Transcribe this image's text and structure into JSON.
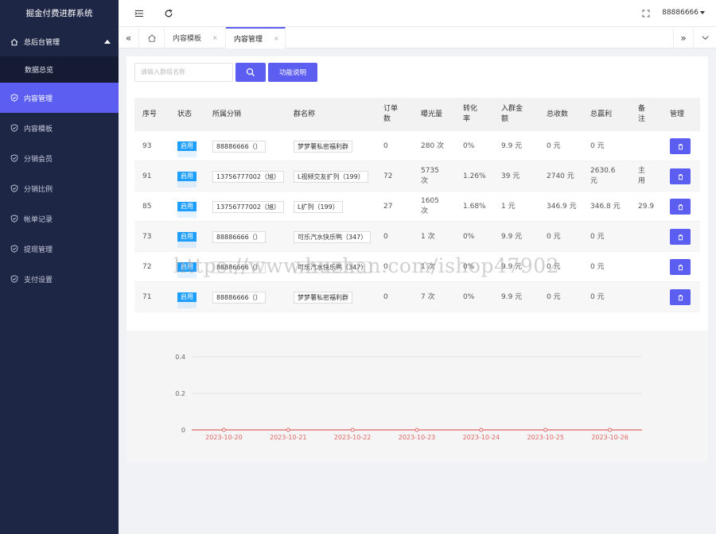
{
  "app": {
    "title": "掘金付费进群系统"
  },
  "sidebar": {
    "group": {
      "label": "总后台管理",
      "icon": "home-icon"
    },
    "subitems": [
      {
        "label": "数据总览"
      }
    ],
    "items": [
      {
        "label": "内容管理",
        "icon": "shield-icon",
        "active": true
      },
      {
        "label": "内容模板",
        "icon": "shield-icon"
      },
      {
        "label": "分销会员",
        "icon": "shield-icon"
      },
      {
        "label": "分销比例",
        "icon": "shield-icon"
      },
      {
        "label": "帐单记录",
        "icon": "shield-icon"
      },
      {
        "label": "提现管理",
        "icon": "shield-icon"
      },
      {
        "label": "支付设置",
        "icon": "shield-icon"
      }
    ]
  },
  "topbar": {
    "user": "88886666"
  },
  "tabs": [
    {
      "label": "内容模板",
      "close": "×"
    },
    {
      "label": "内容管理",
      "close": "×",
      "active": true
    }
  ],
  "toolbar": {
    "search_placeholder": "请输入群组名称",
    "help_label": "功能说明"
  },
  "table": {
    "headers": [
      "序号",
      "状态",
      "所属分销",
      "群名称",
      "订单数",
      "曝光量",
      "转化率",
      "入群金额",
      "总收数",
      "总赢利",
      "备注",
      "管理"
    ],
    "rows": [
      {
        "id": "93",
        "status": "启用",
        "distributor": "88886666（）",
        "group": "梦梦薯私密福利群",
        "orders": "0",
        "views": "280 次",
        "rate": "0%",
        "price": "9.9 元",
        "income": "0 元",
        "profit": "0 元",
        "note": ""
      },
      {
        "id": "91",
        "status": "启用",
        "distributor": "13756777002（旭）",
        "group": "L视频交友扩列（199）",
        "orders": "72",
        "views": "5735 次",
        "rate": "1.26%",
        "price": "39 元",
        "income": "2740 元",
        "profit": "2630.6 元",
        "note": "主用"
      },
      {
        "id": "85",
        "status": "启用",
        "distributor": "13756777002（旭）",
        "group": "L扩列（199）",
        "orders": "27",
        "views": "1605 次",
        "rate": "1.68%",
        "price": "1 元",
        "income": "346.9 元",
        "profit": "346.8 元",
        "note": "29.9"
      },
      {
        "id": "73",
        "status": "启用",
        "distributor": "88886666（）",
        "group": "可乐汽水快乐鸭（347）",
        "orders": "0",
        "views": "1 次",
        "rate": "0%",
        "price": "9.9 元",
        "income": "0 元",
        "profit": "0 元",
        "note": ""
      },
      {
        "id": "72",
        "status": "启用",
        "distributor": "88886666（）",
        "group": "可乐汽水快乐鸭（347）",
        "orders": "0",
        "views": "1 次",
        "rate": "0%",
        "price": "9.9 元",
        "income": "0 元",
        "profit": "0 元",
        "note": ""
      },
      {
        "id": "71",
        "status": "启用",
        "distributor": "88886666（）",
        "group": "梦梦薯私密福利群",
        "orders": "0",
        "views": "7 次",
        "rate": "0%",
        "price": "9.9 元",
        "income": "0 元",
        "profit": "0 元",
        "note": ""
      }
    ]
  },
  "watermark": "https://www.huzhan.com/ishop47902",
  "chart_data": {
    "type": "line",
    "x": [
      "2023-10-20",
      "2023-10-21",
      "2023-10-22",
      "2023-10-23",
      "2023-10-24",
      "2023-10-25",
      "2023-10-26"
    ],
    "series": [
      {
        "values": [
          0,
          0,
          0,
          0,
          0,
          0,
          0
        ],
        "color": "#e06666"
      }
    ],
    "yticks": [
      "0",
      "0.2",
      "0.4"
    ],
    "ylim": [
      0,
      0.4
    ],
    "grid": true
  },
  "colors": {
    "accent": "#5b5ef0",
    "sidebar": "#1e2645",
    "status": "#1e9fff",
    "line": "#e06666"
  }
}
